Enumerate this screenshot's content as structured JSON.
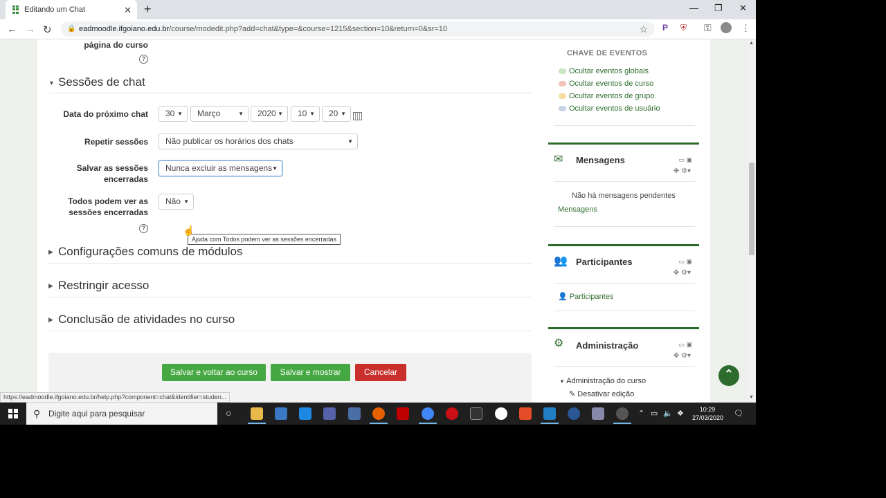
{
  "browser": {
    "tab_title": "Editando um Chat",
    "tab_close": "✕",
    "new_tab": "+",
    "url_host": "eadmoodle.ifgoiano.edu.br",
    "url_path": "/course/modedit.php?add=chat&type=&course=1215&section=10&return=0&sr=10",
    "minimize": "—",
    "restore": "❐",
    "close": "✕"
  },
  "form": {
    "partial_label": "página do curso",
    "section_chat": "Sessões de chat",
    "next_chat_label": "Data do próximo chat",
    "date": {
      "day": "30",
      "month": "Março",
      "year": "2020",
      "hour": "10",
      "minute": "20"
    },
    "repeat_label": "Repetir sessões",
    "repeat_value": "Não publicar os horários dos chats",
    "save_sessions_label_1": "Salvar as sessões",
    "save_sessions_label_2": "encerradas",
    "save_sessions_value": "Nunca excluir as mensagens",
    "everyone_label_1": "Todos podem ver as",
    "everyone_label_2": "sessões encerradas",
    "everyone_value": "Não",
    "tooltip": "Ajuda com Todos podem ver as sessões encerradas",
    "section_common": "Configurações comuns de módulos",
    "section_restrict": "Restringir acesso",
    "section_completion": "Conclusão de atividades no curso",
    "btn_save_return": "Salvar e voltar ao curso",
    "btn_save_show": "Salvar e mostrar",
    "btn_cancel": "Cancelar"
  },
  "sidebar": {
    "events_heading": "CHAVE DE EVENTOS",
    "events": [
      {
        "label": "Ocultar eventos globais",
        "color": "#c9e6c0"
      },
      {
        "label": "Ocultar eventos de curso",
        "color": "#f3c2b8"
      },
      {
        "label": "Ocultar eventos de grupo",
        "color": "#f6dc9e"
      },
      {
        "label": "Ocultar eventos de usuário",
        "color": "#c9d3e6"
      }
    ],
    "messages_title": "Mensagens",
    "messages_empty": "Não há mensagens pendentes",
    "messages_link": "Mensagens",
    "participants_title": "Participantes",
    "participants_link": "Participantes",
    "admin_title": "Administração",
    "admin_course": "Administração do curso",
    "admin_disable_edit": "Desativar edição"
  },
  "status_url": "https://eadmoodle.ifgoiano.edu.br/help.php?component=chat&identifier=studen...",
  "taskbar": {
    "search_placeholder": "Digite aqui para pesquisar",
    "time": "10:29",
    "date": "27/03/2020"
  },
  "colors": {
    "moodle_green": "#2d6a2d",
    "button_green": "#46a842",
    "button_red": "#c9302c"
  }
}
